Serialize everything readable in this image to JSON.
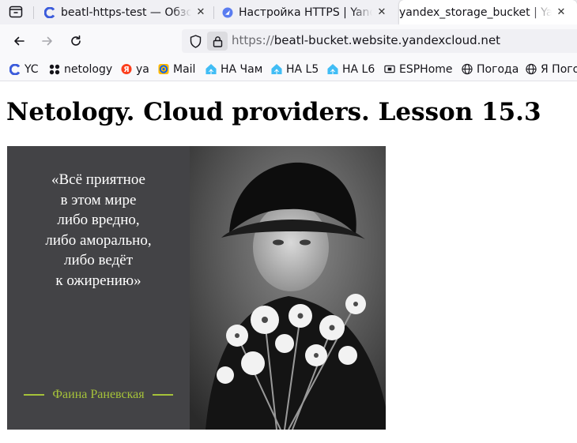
{
  "tabs": [
    {
      "title": "beatl-https-test — Обзор",
      "favicon": "yandex-cloud-icon",
      "active": false
    },
    {
      "title": "Настройка HTTPS | Yandex",
      "favicon": "yandex-docs-icon",
      "active": false
    },
    {
      "title": "yandex_storage_bucket | Yandex",
      "favicon": "none",
      "active": true
    }
  ],
  "navigation": {
    "url_scheme": "https://",
    "url_host": "beatl-bucket.website.yandexcloud.net"
  },
  "bookmarks": [
    {
      "label": "YC",
      "icon": "yandex-cloud-icon"
    },
    {
      "label": "netology",
      "icon": "netology-icon"
    },
    {
      "label": "ya",
      "icon": "yandex-icon"
    },
    {
      "label": "Mail",
      "icon": "mail-icon"
    },
    {
      "label": "НА Чам",
      "icon": "home-assistant-icon"
    },
    {
      "label": "НА L5",
      "icon": "home-assistant-icon"
    },
    {
      "label": "НА L6",
      "icon": "home-assistant-icon"
    },
    {
      "label": "ESPHome",
      "icon": "esphome-icon"
    },
    {
      "label": "Погода",
      "icon": "globe-icon"
    },
    {
      "label": "Я Пого",
      "icon": "globe-icon"
    }
  ],
  "page": {
    "heading": "Netology. Cloud providers. Lesson 15.3",
    "quote_lines": [
      "«Всё приятное",
      "в этом мире",
      "либо вредно,",
      "либо аморально,",
      "либо ведёт",
      "к ожирению»"
    ],
    "quote_author": "Фаина Раневская"
  },
  "colors": {
    "quote_panel": "#434346",
    "author_accent": "#a5c23a",
    "tab_strip": "#f0f0f4"
  }
}
